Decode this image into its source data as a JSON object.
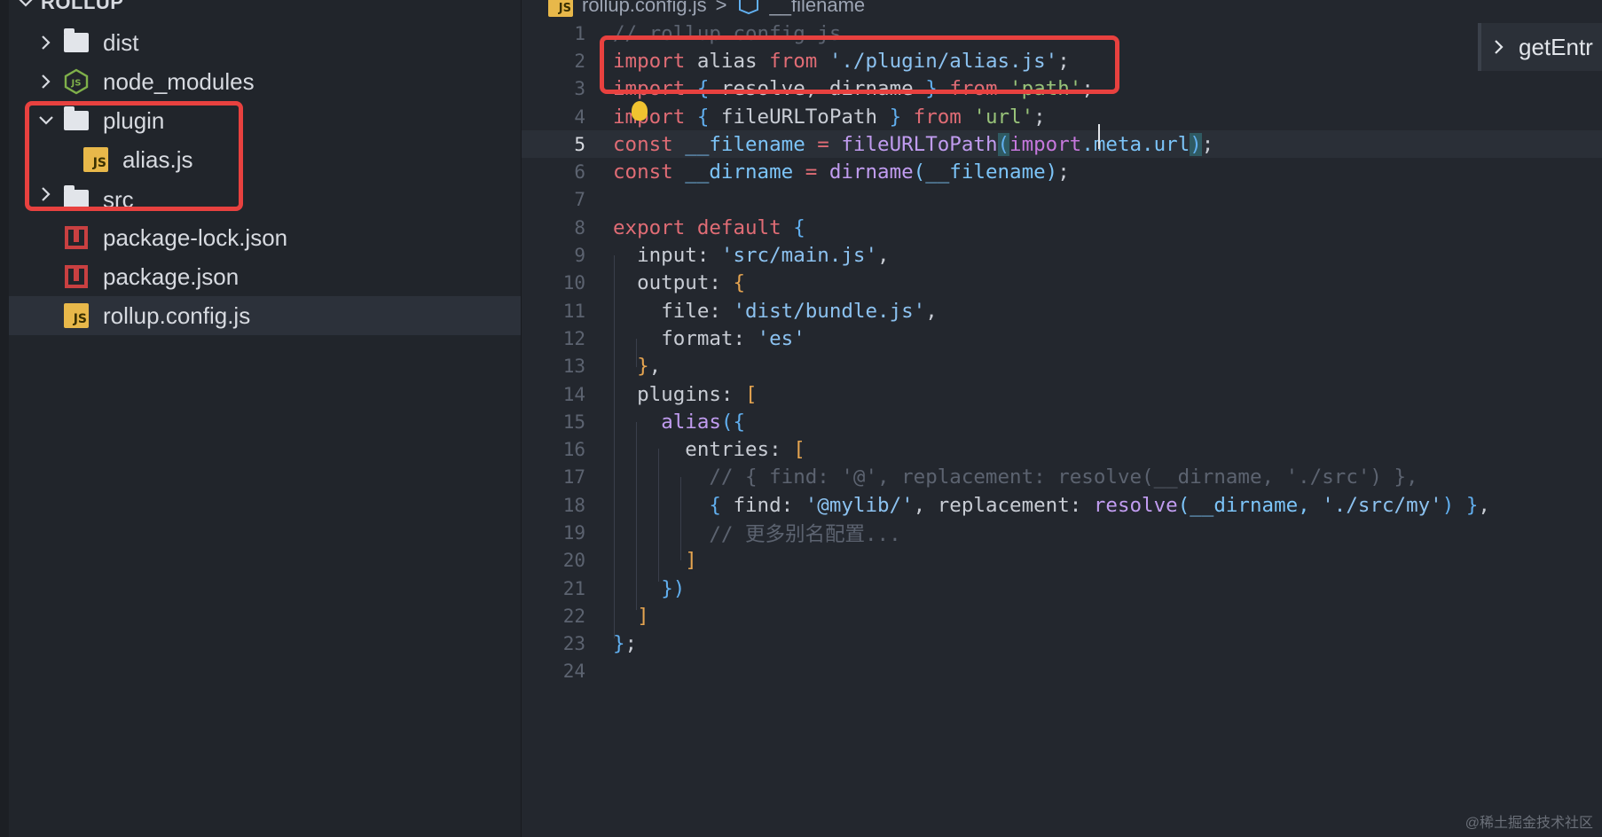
{
  "sidebar": {
    "root_label": "ROLLUP",
    "items": [
      {
        "label": "dist",
        "icon": "folder-icon",
        "expanded": false
      },
      {
        "label": "node_modules",
        "icon": "nodejs-icon",
        "expanded": false
      },
      {
        "label": "plugin",
        "icon": "folder-icon",
        "expanded": true
      },
      {
        "label": "alias.js",
        "icon": "js-file-icon"
      },
      {
        "label": "src",
        "icon": "folder-icon",
        "expanded": false
      },
      {
        "label": "package-lock.json",
        "icon": "npm-icon"
      },
      {
        "label": "package.json",
        "icon": "npm-icon"
      },
      {
        "label": "rollup.config.js",
        "icon": "js-file-icon",
        "selected": true
      }
    ]
  },
  "breadcrumb": {
    "file": "rollup.config.js",
    "separator": ">",
    "symbol": "__filename",
    "file_badge": "JS"
  },
  "outline_button": {
    "label": "getEntr"
  },
  "editor": {
    "active_line": 5,
    "line_numbers": [
      "1",
      "2",
      "3",
      "4",
      "5",
      "6",
      "7",
      "8",
      "9",
      "10",
      "11",
      "12",
      "13",
      "14",
      "15",
      "16",
      "17",
      "18",
      "19",
      "20",
      "21",
      "22",
      "23",
      "24"
    ]
  },
  "code": {
    "l1": "// rollup.config.js",
    "l2_import": "import",
    "l2_alias": " alias ",
    "l2_from": "from",
    "l2_path": " './plugin/alias.js'",
    "l2_semi": ";",
    "l3_import": "import",
    "l3_open": " { ",
    "l3_names": "resolve, dirname",
    "l3_close": " } ",
    "l3_from": "from",
    "l3_path": " 'path'",
    "l3_semi": ";",
    "l4_import": "import",
    "l4_open": " { ",
    "l4_name": "fileURLToPath",
    "l4_close": " } ",
    "l4_from": "from",
    "l4_path": " 'url'",
    "l4_semi": ";",
    "l5_const": "const",
    "l5_var": " __filename ",
    "l5_eq": "= ",
    "l5_fn": "fileURLToPath",
    "l5_open": "(",
    "l5_import": "import",
    "l5_meta": ".meta.url",
    "l5_close": ")",
    "l5_semi": ";",
    "l6_const": "const",
    "l6_var": " __dirname ",
    "l6_eq": "= ",
    "l6_fn": "dirname",
    "l6_args": "(__filename)",
    "l6_semi": ";",
    "l8_export": "export default",
    "l8_brace": " {",
    "l9_key": "input: ",
    "l9_val": "'src/main.js'",
    "l9_comma": ",",
    "l10_key": "output: ",
    "l10_brace": "{",
    "l11_key": "file: ",
    "l11_val": "'dist/bundle.js'",
    "l11_comma": ",",
    "l12_key": "format: ",
    "l12_val": "'es'",
    "l13_close": "}",
    "l13_comma": ",",
    "l14_key": "plugins: ",
    "l14_bracket": "[",
    "l15_fn": "alias",
    "l15_open": "({",
    "l16_key": "entries: ",
    "l16_bracket": "[",
    "l17": "// { find: '@', replacement: resolve(__dirname, './src') },",
    "l18_open": "{ ",
    "l18_key1": "find: ",
    "l18_val1": "'@mylib/'",
    "l18_comma": ", ",
    "l18_key2": "replacement: ",
    "l18_fn": "resolve",
    "l18_args": "(__dirname, ",
    "l18_val2": "'./src/my'",
    "l18_end": ") }",
    "l18_trail": ",",
    "l19": "// 更多别名配置...",
    "l20": "]",
    "l21": "})",
    "l22": "]",
    "l23_brace": "}",
    "l23_semi": ";"
  },
  "watermark": "@稀土掘金技术社区",
  "colors": {
    "highlight_box": "#e8413f",
    "keyword": "#e06c75",
    "string": "#98c379",
    "function": "#c19cf0"
  }
}
